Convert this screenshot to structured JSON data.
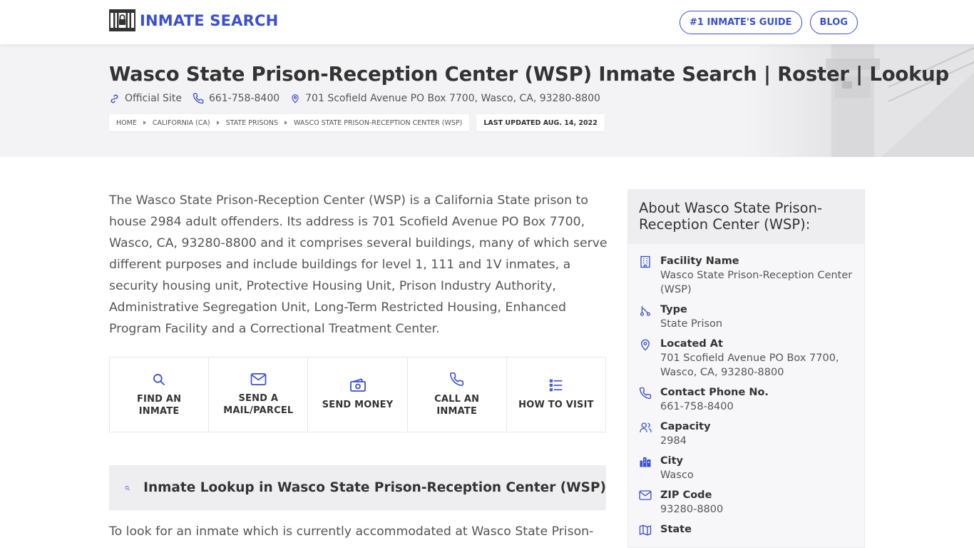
{
  "header": {
    "logo_text": "INMATE SEARCH",
    "nav": [
      "#1 INMATE'S GUIDE",
      "BLOG"
    ]
  },
  "hero": {
    "title": "Wasco State Prison-Reception Center (WSP) Inmate Search | Roster | Lookup",
    "official_site": "Official Site",
    "phone": "661-758-8400",
    "address": "701 Scofield Avenue PO Box 7700, Wasco, CA, 93280-8800",
    "breadcrumbs": [
      "HOME",
      "CALIFORNIA (CA)",
      "STATE PRISONS",
      "WASCO STATE PRISON-RECEPTION CENTER (WSP)"
    ],
    "last_updated": "LAST UPDATED AUG. 14, 2022"
  },
  "main": {
    "intro": "The Wasco State Prison-Reception Center (WSP) is a California State prison to house 2984 adult offenders. Its address is 701 Scofield Avenue PO Box 7700, Wasco, CA, 93280-8800 and it comprises several buildings, many of which serve different purposes and include buildings for level 1, 111 and 1V inmates, a security housing unit, Protective Housing Unit, Prison Industry Authority, Administrative Segregation Unit, Long-Term Restricted Housing, Enhanced Program Facility and a Correctional Treatment Center.",
    "actions": [
      {
        "label": "FIND AN INMATE",
        "icon": "search-icon"
      },
      {
        "label": "SEND A MAIL/PARCEL",
        "icon": "mail-icon"
      },
      {
        "label": "SEND MONEY",
        "icon": "money-icon"
      },
      {
        "label": "CALL AN INMATE",
        "icon": "phone-icon"
      },
      {
        "label": "HOW TO VISIT",
        "icon": "list-icon"
      }
    ],
    "lookup_title": "Inmate Lookup in Wasco State Prison-Reception Center (WSP)",
    "tail_text": "To look for an inmate which is currently accommodated at Wasco State Prison-"
  },
  "sidebar": {
    "title": "About Wasco State Prison-Reception Center (WSP):",
    "facts": [
      {
        "label": "Facility Name",
        "value": "Wasco State Prison-Reception Center (WSP)",
        "icon": "building-icon"
      },
      {
        "label": "Type",
        "value": "State Prison",
        "icon": "route-icon"
      },
      {
        "label": "Located At",
        "value": "701 Scofield Avenue PO Box 7700, Wasco, CA, 93280-8800",
        "icon": "map-pin-icon"
      },
      {
        "label": "Contact Phone No.",
        "value": "661-758-8400",
        "icon": "phone-icon"
      },
      {
        "label": "Capacity",
        "value": "2984",
        "icon": "users-icon"
      },
      {
        "label": "City",
        "value": "Wasco",
        "icon": "city-icon"
      },
      {
        "label": "ZIP Code",
        "value": "93280-8800",
        "icon": "mail-icon"
      },
      {
        "label": "State",
        "value": "",
        "icon": "map-icon"
      }
    ]
  },
  "colors": {
    "accent": "#3a4fd1",
    "text": "#333333",
    "muted": "#555555",
    "hero_bg": "#f3f3f5"
  }
}
